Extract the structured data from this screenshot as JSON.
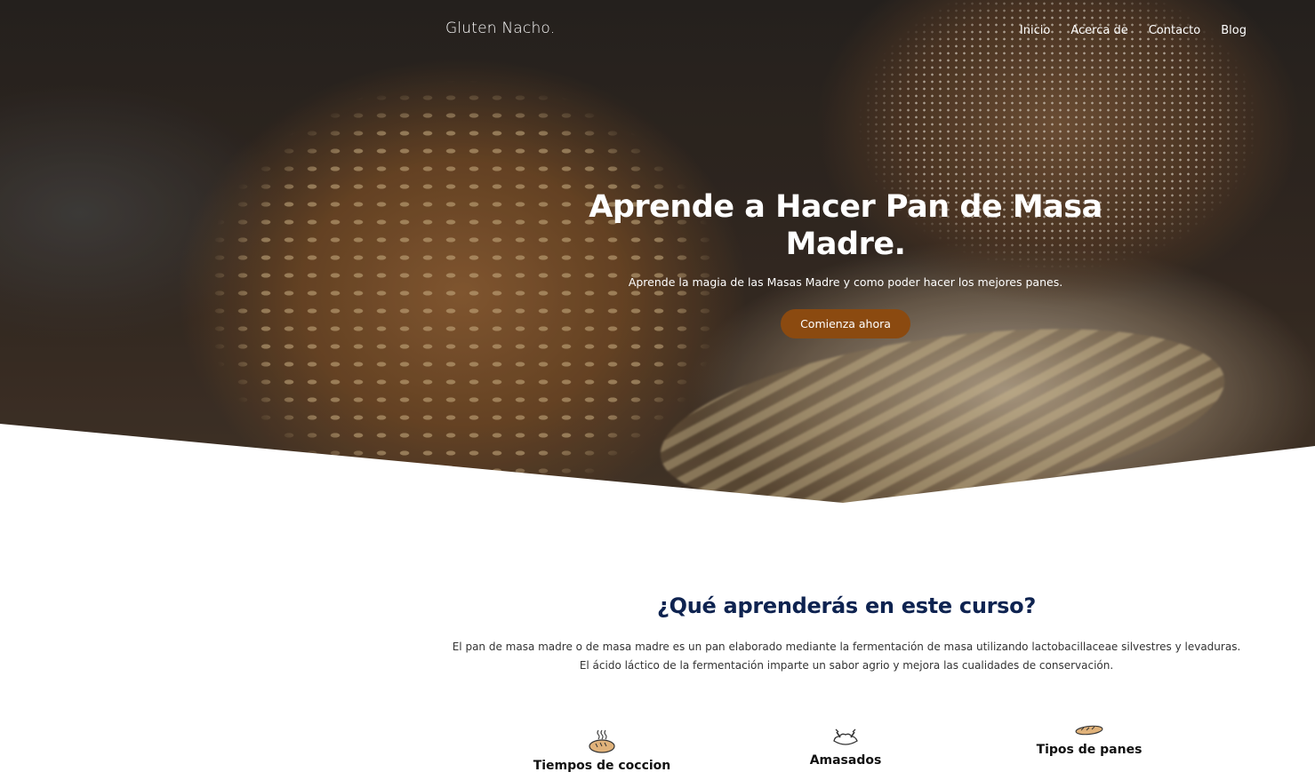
{
  "header": {
    "brand": "Gluten Nacho.",
    "nav": [
      "Inicio",
      "Acerca de",
      "Contacto",
      "Blog"
    ]
  },
  "hero": {
    "title": "Aprende a Hacer Pan de Masa Madre.",
    "subtitle": "Aprende la magia de las Masas Madre y como poder hacer los mejores panes.",
    "cta_label": "Comienza ahora"
  },
  "learn": {
    "title": "¿Qué aprenderás en este curso?",
    "desc_line1": "El pan de masa madre o de masa madre es un pan elaborado mediante la fermentación de masa utilizando lactobacillaceae silvestres y levaduras.",
    "desc_line2": "El ácido láctico de la fermentación imparte un sabor agrio y mejora las cualidades de conservación."
  },
  "features": [
    {
      "label": "Tiempos de coccion",
      "icon": "bread-loaf-steam-icon"
    },
    {
      "label": "Amasados",
      "icon": "kneading-dough-icon"
    },
    {
      "label": "Tipos de panes",
      "icon": "baguette-icon"
    }
  ],
  "colors": {
    "accent": "#8b4a10",
    "heading": "#0e2350"
  }
}
